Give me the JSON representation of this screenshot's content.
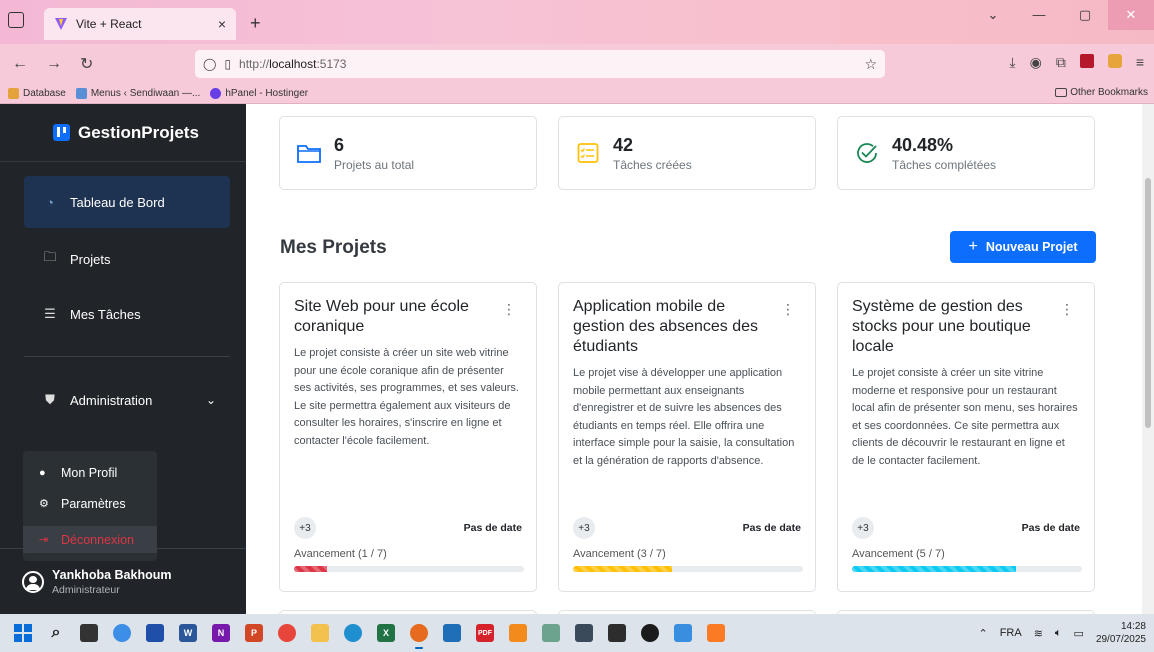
{
  "browser": {
    "tab_title": "Vite + React",
    "tab_close": "×",
    "new_tab": "+",
    "url_scheme": "http://",
    "url_host": "localhost",
    "url_port": ":5173",
    "bookmarks": [
      {
        "label": "Database",
        "color": "#e3a23b"
      },
      {
        "label": "Menus ‹ Sendiwaan —...",
        "color": "#5a8fd6"
      },
      {
        "label": "hPanel - Hostinger",
        "color": "#673de6"
      }
    ],
    "other_bookmarks": "Other Bookmarks"
  },
  "sidebar": {
    "brand": "GestionProjets",
    "items": [
      {
        "label": "Tableau de Bord",
        "icon": "gauge-icon",
        "active": true
      },
      {
        "label": "Projets",
        "icon": "folder-icon"
      },
      {
        "label": "Mes Tâches",
        "icon": "list-icon"
      },
      {
        "label": "Administration",
        "icon": "shield-icon"
      }
    ],
    "dropdown": {
      "profile": "Mon Profil",
      "settings": "Paramètres",
      "logout": "Déconnexion"
    },
    "user": {
      "name": "Yankhoba Bakhoum",
      "role": "Administrateur"
    }
  },
  "stats": [
    {
      "value": "6",
      "label": "Projets au total",
      "icon": "folder-icon",
      "color": "#0d6efd"
    },
    {
      "value": "42",
      "label": "Tâches créées",
      "icon": "task-list-icon",
      "color": "#ffc107"
    },
    {
      "value": "40.48%",
      "label": "Tâches complétées",
      "icon": "check-circle-icon",
      "color": "#198754"
    }
  ],
  "main": {
    "section_title": "Mes Projets",
    "new_project_plus": "+",
    "new_project_label": "Nouveau Projet"
  },
  "projects": [
    {
      "title": "Site Web pour une école coranique",
      "description": "Le projet consiste à créer un site web vitrine pour une école coranique afin de présenter ses activités, ses programmes, et ses valeurs. Le site permettra également aux visiteurs de consulter les horaires, s'inscrire en ligne et contacter l'école facilement.",
      "members": "+3",
      "date": "Pas de date",
      "progress_label": "Avancement (1 / 7)",
      "progress": 0.143,
      "color": "#dc3545"
    },
    {
      "title": "Application mobile de gestion des absences des étudiants",
      "description": "Le projet vise à développer une application mobile permettant aux enseignants d'enregistrer et de suivre les absences des étudiants en temps réel. Elle offrira une interface simple pour la saisie, la consultation et la génération de rapports d'absence.",
      "members": "+3",
      "date": "Pas de date",
      "progress_label": "Avancement (3 / 7)",
      "progress": 0.429,
      "color": "#ffc107"
    },
    {
      "title": "Système de gestion des stocks pour une boutique locale",
      "description": "Le projet consiste à créer un site vitrine moderne et responsive pour un restaurant local afin de présenter son menu, ses horaires et ses coordonnées. Ce site permettra aux clients de découvrir le restaurant en ligne et de le contacter facilement.",
      "members": "+3",
      "date": "Pas de date",
      "progress_label": "Avancement (5 / 7)",
      "progress": 0.714,
      "color": "#0dcaf0"
    }
  ],
  "taskbar": {
    "lang": "FRA",
    "time": "14:28",
    "date": "29/07/2025"
  }
}
